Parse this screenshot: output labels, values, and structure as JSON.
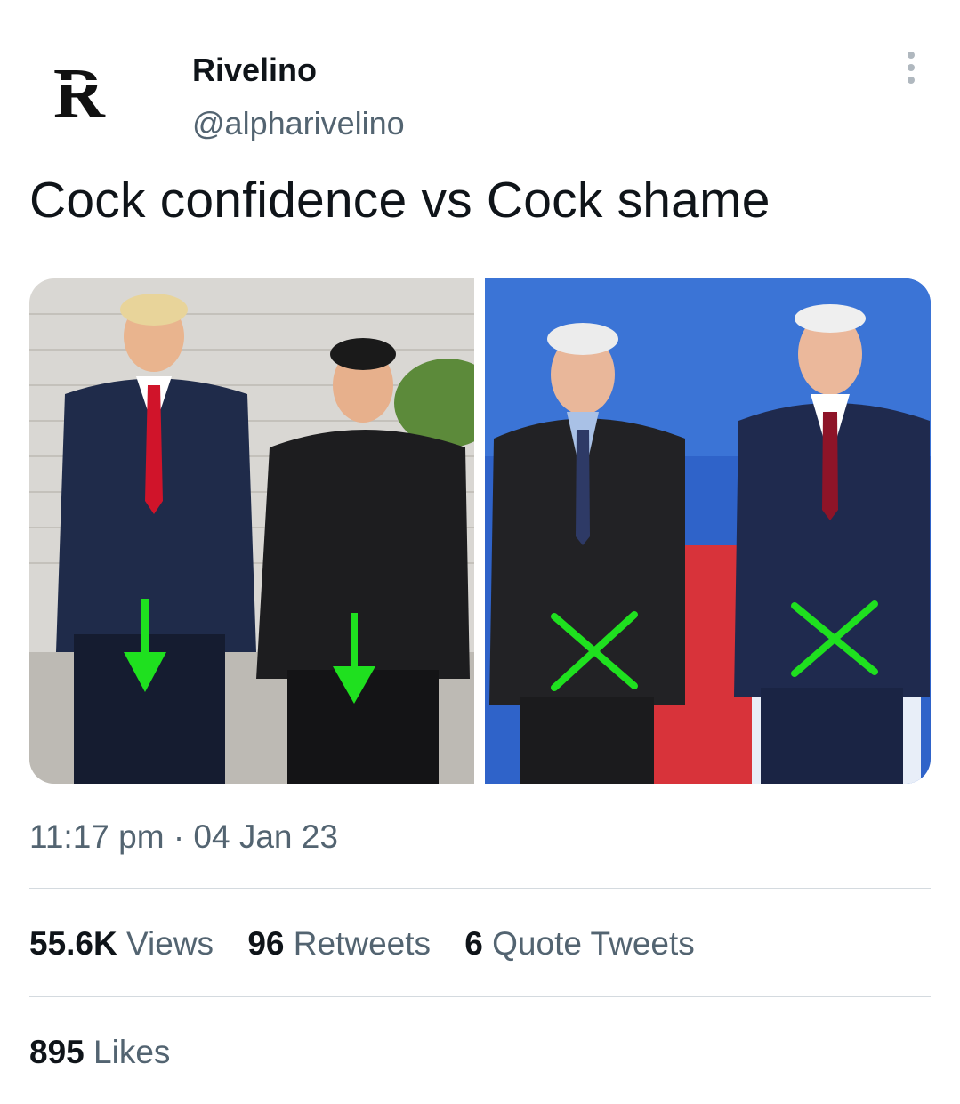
{
  "author": {
    "avatar_letter": "R",
    "name": "Rivelino",
    "handle": "@alpharivelino"
  },
  "tweet": {
    "text": "Cock confidence vs Cock shame",
    "time": "11:17 pm",
    "separator": "·",
    "date": "04 Jan 23"
  },
  "media": {
    "left_photo": "photo-confidence",
    "right_photo": "photo-shame",
    "marker_color": "#1fe01f"
  },
  "stats": {
    "views_count": "55.6K",
    "views_label": "Views",
    "retweets_count": "96",
    "retweets_label": "Retweets",
    "quotes_count": "6",
    "quotes_label": "Quote Tweets",
    "likes_count": "895",
    "likes_label": "Likes"
  },
  "icons": {
    "more": "more-vertical-icon"
  }
}
